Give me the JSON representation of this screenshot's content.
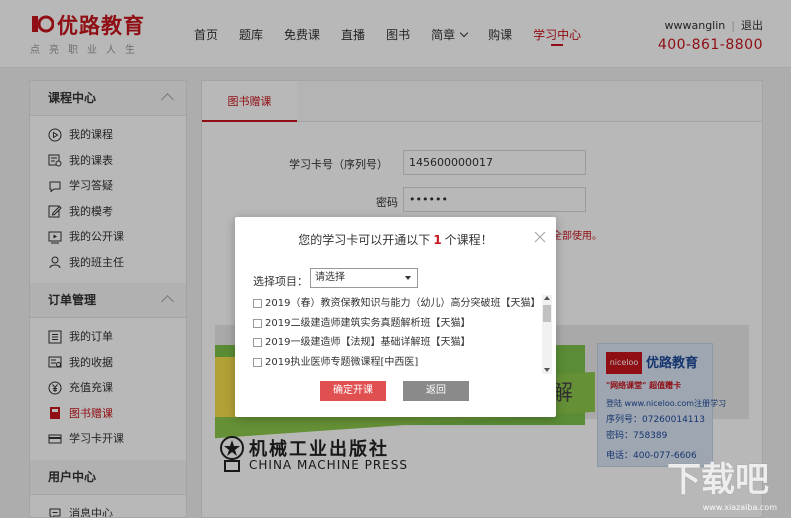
{
  "header": {
    "logo_name": "优路教育",
    "logo_slogan": "点亮职业人生",
    "nav": [
      {
        "label": "首页"
      },
      {
        "label": "题库"
      },
      {
        "label": "免费课"
      },
      {
        "label": "直播"
      },
      {
        "label": "图书"
      },
      {
        "label": "简章"
      },
      {
        "label": "购课"
      },
      {
        "label": "学习中心"
      }
    ],
    "username": "wwwanglin",
    "logout": "退出",
    "phone": "400-861-8800"
  },
  "sidebar": {
    "sections": [
      {
        "title": "课程中心",
        "items": [
          {
            "label": "我的课程",
            "icon": "play-circle-icon"
          },
          {
            "label": "我的课表",
            "icon": "schedule-icon"
          },
          {
            "label": "学习答疑",
            "icon": "chat-bubble-icon"
          },
          {
            "label": "我的模考",
            "icon": "edit-icon"
          },
          {
            "label": "我的公开课",
            "icon": "video-icon"
          },
          {
            "label": "我的班主任",
            "icon": "person-icon"
          }
        ]
      },
      {
        "title": "订单管理",
        "items": [
          {
            "label": "我的订单",
            "icon": "order-list-icon"
          },
          {
            "label": "我的收据",
            "icon": "receipt-icon"
          },
          {
            "label": "充值充课",
            "icon": "yuan-coin-icon"
          },
          {
            "label": "图书赠课",
            "icon": "book-icon"
          },
          {
            "label": "学习卡开课",
            "icon": "card-icon"
          }
        ]
      },
      {
        "title": "用户中心",
        "items": [
          {
            "label": "消息中心",
            "icon": "message-icon"
          }
        ]
      }
    ]
  },
  "main": {
    "tab": "图书赠课",
    "form": {
      "card_label": "学习卡号（序列号）",
      "card_value": "145600000017",
      "password_label": "密码",
      "password_value": "••••••",
      "hint_tail": "全部使用。"
    },
    "book": {
      "partial_char": "解",
      "card_brand": "优路教育",
      "card_logo": "niceloo",
      "card_line1": "\"网络课堂\" 超值赠卡",
      "card_line2": "登陆 www.niceloo.com注册学习",
      "card_line3": "序列号：07260014113",
      "card_line4": "密码：758389",
      "card_line5": "电话：400-077-6606",
      "publisher_cn": "机械工业出版社",
      "publisher_en": "CHINA MACHINE PRESS"
    }
  },
  "dialog": {
    "title_prefix": "您的学习卡可以开通以下",
    "count": "1",
    "title_suffix": "个课程！",
    "select_label": "选择项目：",
    "select_value": "请选择",
    "courses": [
      "2019（春）教资保教知识与能力（幼儿）高分突破班【天猫】",
      "2019二级建造师建筑实务真题解析班【天猫】",
      "2019一级建造师【法规】基础详解班【天猫】",
      "2019执业医师专题微课程[中西医]"
    ],
    "confirm": "确定开课",
    "back": "返回"
  },
  "watermark": {
    "text": "下载吧",
    "url": "www.xiazaiba.com"
  },
  "colors": {
    "brand_red": "#c8161e",
    "confirm_button": "#e05050",
    "back_button": "#8a8a8a"
  }
}
